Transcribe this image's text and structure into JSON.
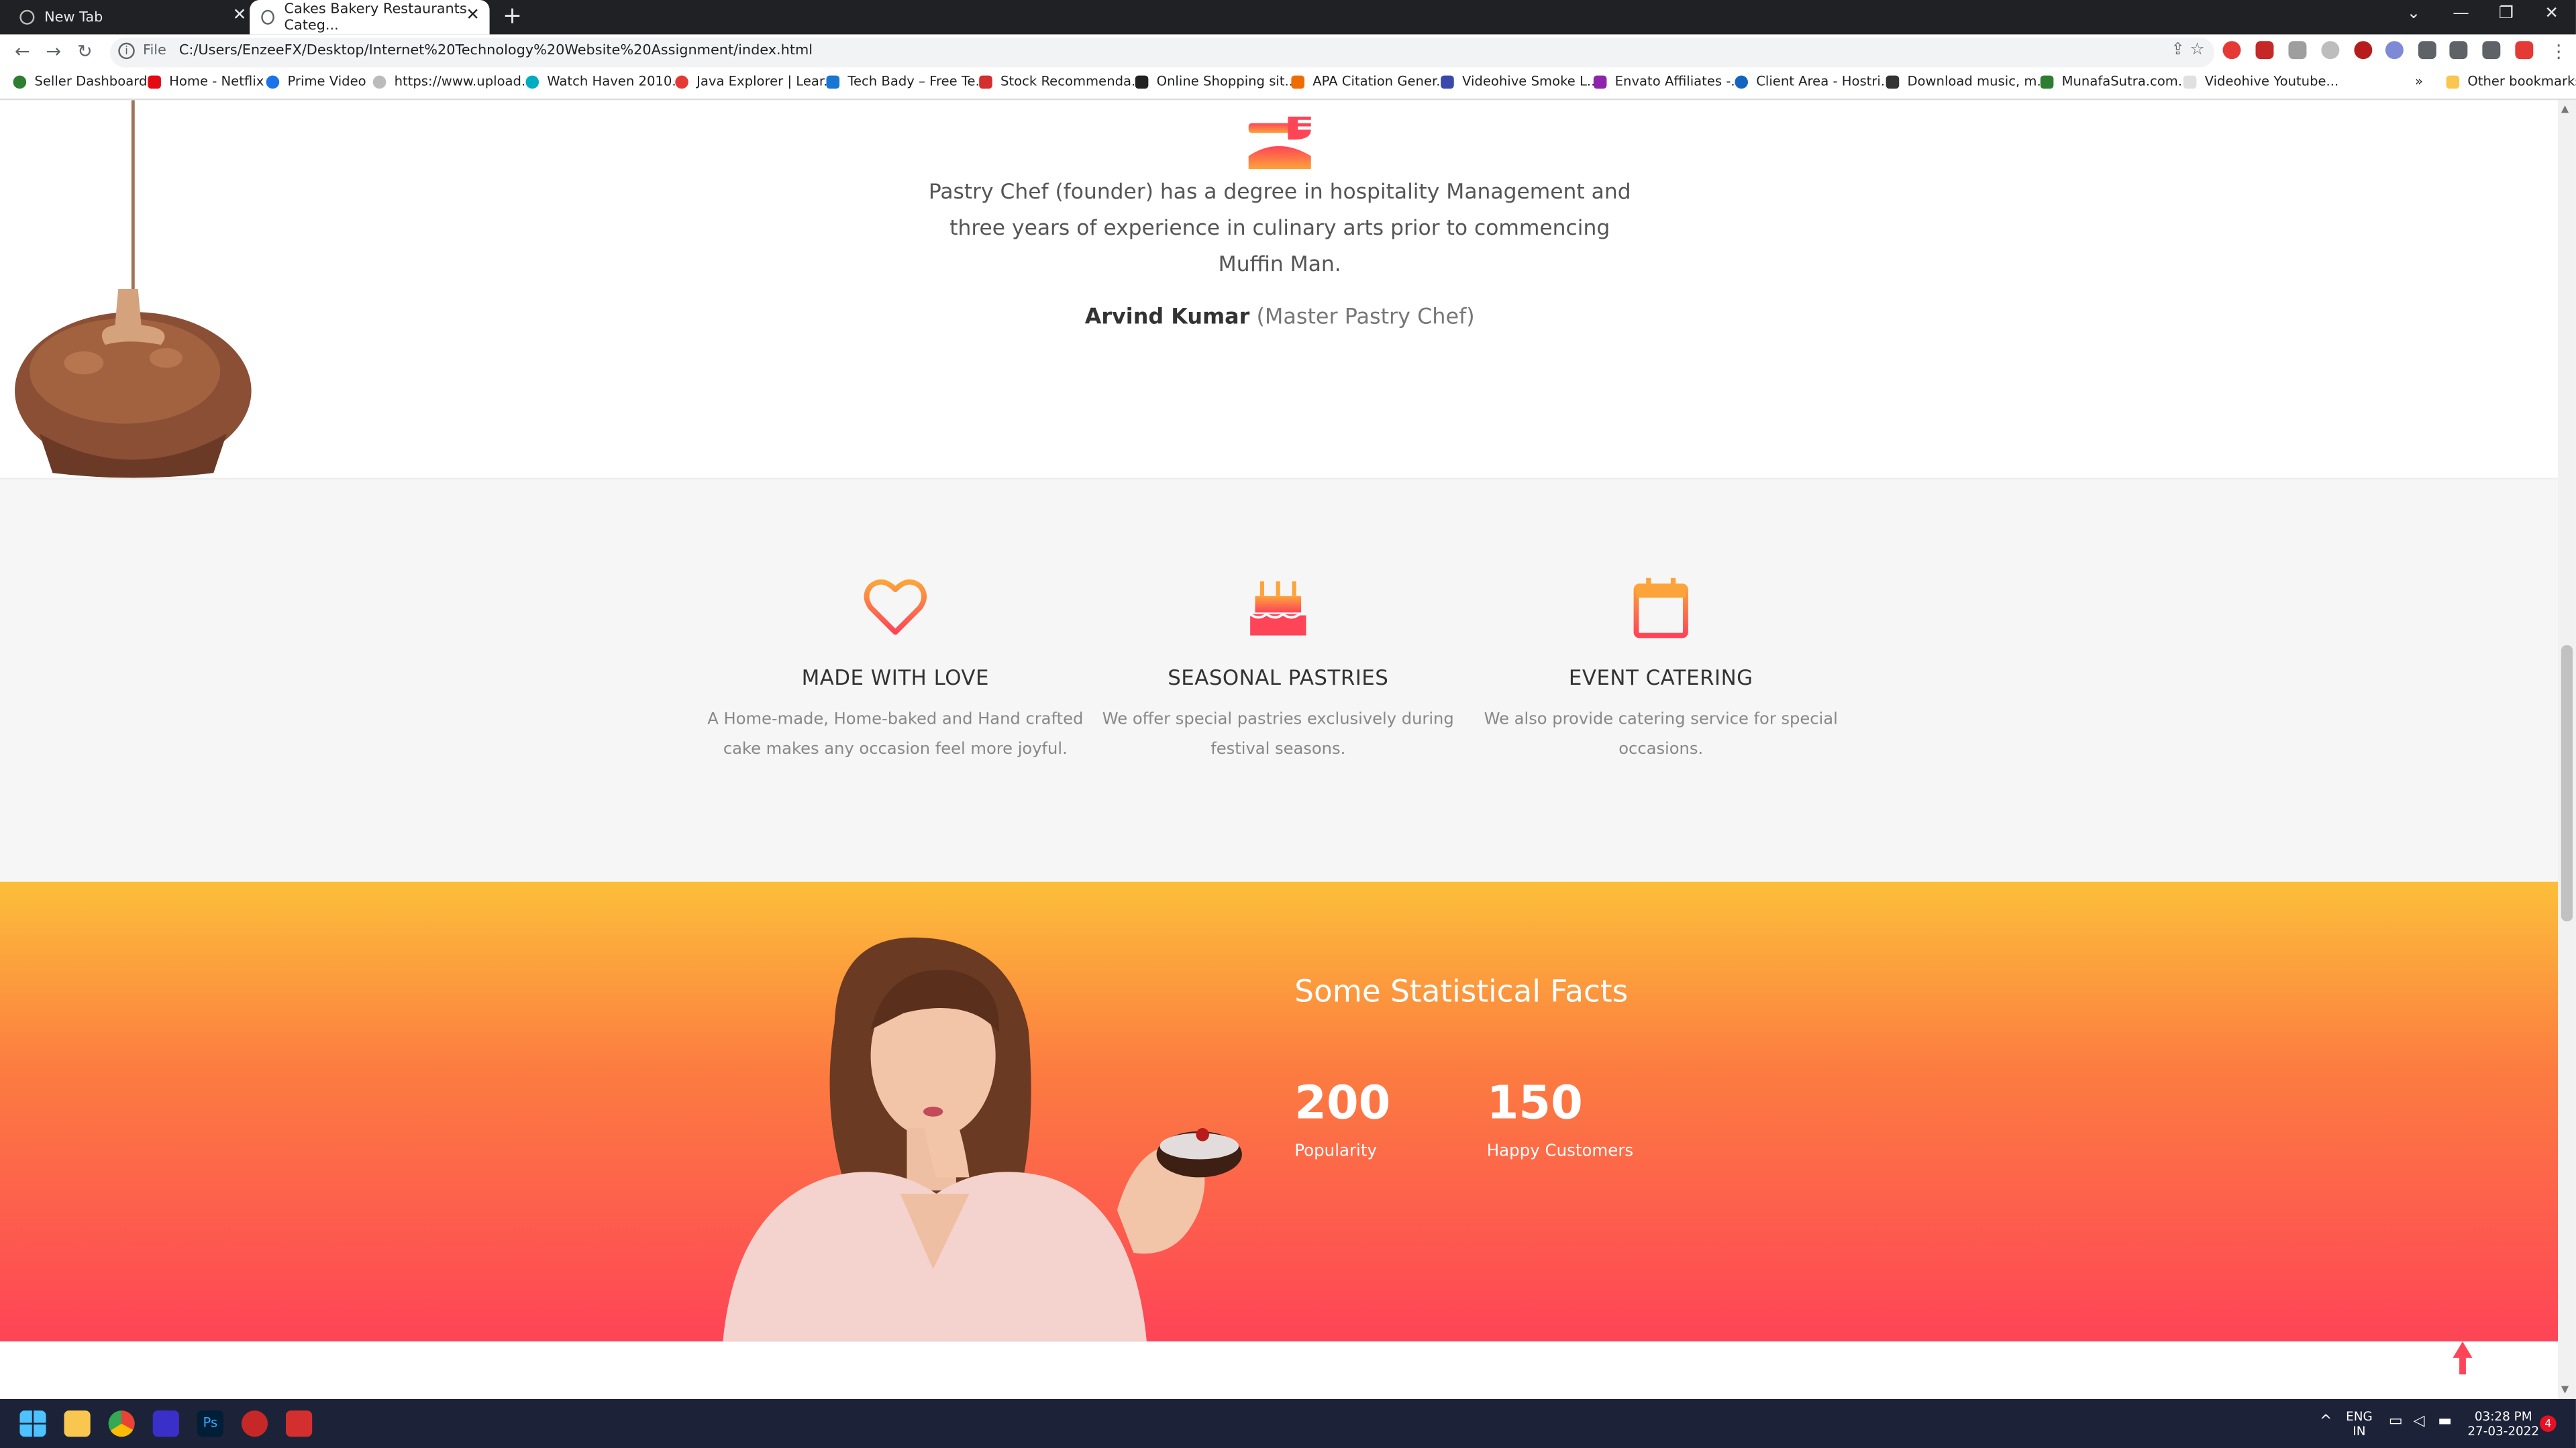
{
  "browser": {
    "tabs": [
      {
        "title": "New Tab",
        "active": false
      },
      {
        "title": "Cakes Bakery Restaurants Categ...",
        "active": true
      }
    ],
    "new_tab_symbol": "+",
    "address": {
      "scheme_label": "File",
      "url": "C:/Users/EnzeeFX/Desktop/Internet%20Technology%20Website%20Assignment/index.html"
    },
    "bookmarks": [
      "Seller Dashboard",
      "Home - Netflix",
      "Prime Video",
      "https://www.upload...",
      "Watch Haven 2010...",
      "Java Explorer | Lear...",
      "Tech Bady – Free Te...",
      "Stock Recommenda...",
      "Online Shopping sit...",
      "APA Citation Gener...",
      "Videohive Smoke L...",
      "Envato Affiliates -...",
      "Client Area - Hostri...",
      "Download music, m...",
      "MunafaSutra.com...",
      "Videohive Youtube..."
    ],
    "bookmark_overflow": "»",
    "other_bookmarks": "Other bookmarks"
  },
  "about": {
    "text": "Pastry Chef (founder) has a degree in hospitality Management and three years of experience in culinary arts prior to commencing Muffin Man.",
    "chef_name": "Arvind Kumar",
    "chef_role": "(Master Pastry Chef)"
  },
  "features": [
    {
      "icon": "heart-icon",
      "title": "MADE WITH LOVE",
      "text": "A Home-made, Home-baked and Hand crafted cake makes any occasion feel more joyful."
    },
    {
      "icon": "birthday-cake-icon",
      "title": "SEASONAL PASTRIES",
      "text": "We offer special pastries exclusively during festival seasons."
    },
    {
      "icon": "calendar-icon",
      "title": "EVENT CATERING",
      "text": "We also provide catering service for special occasions."
    }
  ],
  "stats": {
    "title": "Some Statistical Facts",
    "items": [
      {
        "value": "200",
        "label": "Popularity"
      },
      {
        "value": "150",
        "label": "Happy Customers"
      }
    ]
  },
  "taskbar": {
    "language": "ENG",
    "region": "IN",
    "time": "03:28 PM",
    "date": "27-03-2022",
    "notifications": "4"
  },
  "colors": {
    "gradient_top": "#fcbf3a",
    "gradient_bottom": "#fe4457",
    "icon_orange": "#fca43a",
    "icon_red": "#fe4457"
  }
}
